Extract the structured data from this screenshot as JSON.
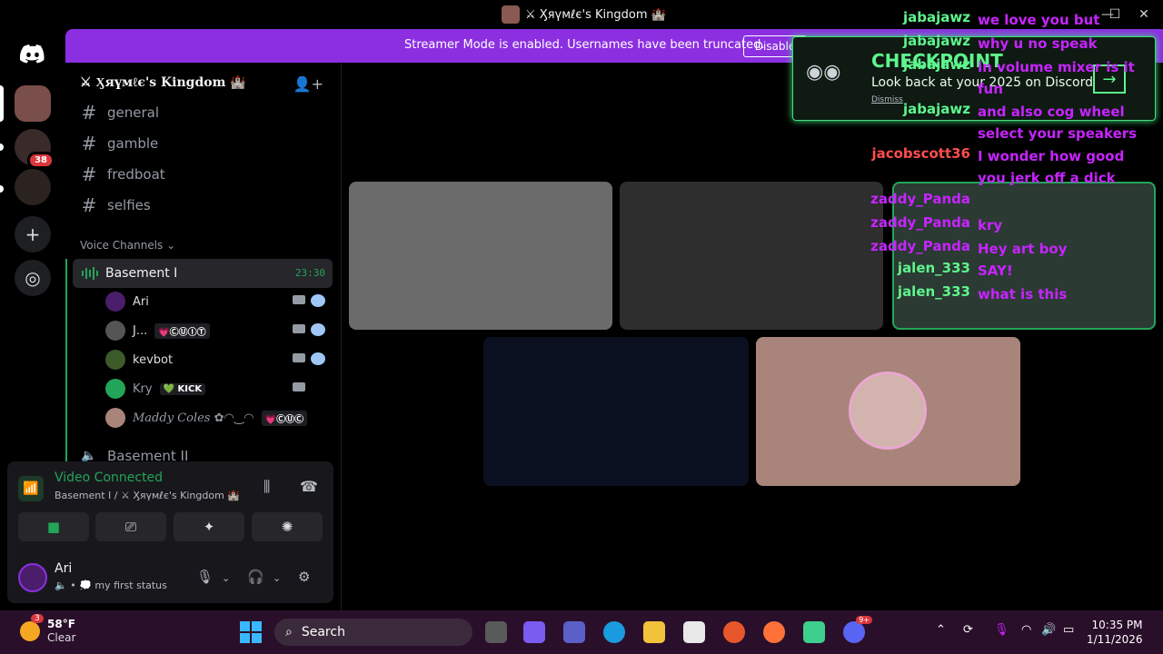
{
  "window": {
    "title": "⚔ Ӽяүмℓє's Kingdom 🏰"
  },
  "banner": {
    "message": "Streamer Mode is enabled. Usernames have been truncated.",
    "button": "Disable"
  },
  "guilds": {
    "dm_badge": "38"
  },
  "server": {
    "name": "⚔ Ӽяүмℓє's Kingdom 🏰"
  },
  "channels": [
    {
      "name": "general"
    },
    {
      "name": "gamble"
    },
    {
      "name": "fredboat"
    },
    {
      "name": "selfies"
    }
  ],
  "voice": {
    "category": "Voice Channels",
    "channel": "Basement I",
    "timer": "23:30",
    "users": [
      {
        "name": "Ari",
        "tag": ""
      },
      {
        "name": "J...",
        "tag": "💗ⒸⓊⒾⓉ"
      },
      {
        "name": "kevbot",
        "tag": ""
      },
      {
        "name": "Kry",
        "tag": "💚 KICK"
      },
      {
        "name": "𝑀𝑎𝑑𝑑𝑦 𝐶𝑜𝑙𝑒𝑠 ✿◠‿◠",
        "tag": "💗ⒸⓊⒸ"
      }
    ],
    "next_channel": "Basement II"
  },
  "connection": {
    "status": "Video Connected",
    "location": "Basement I / ⚔ Ӽяүмℓє's Kingdom 🏰"
  },
  "user": {
    "name": "Ari",
    "status": "my first status"
  },
  "promo": {
    "title": "CHECKPOINT",
    "subtitle": "Look back at your 2025 on Discord",
    "dismiss": "Dismiss"
  },
  "chat": [
    {
      "user": "jabajawz",
      "msg": "we love you but",
      "color": "#5ef58d"
    },
    {
      "user": "jabajawz",
      "msg": "why u no speak",
      "color": "#5ef58d"
    },
    {
      "user": "jabajawz",
      "msg": "in volume mixer is it fun",
      "color": "#5ef58d"
    },
    {
      "user": "jabajawz",
      "msg": "and also cog wheel select your speakers",
      "color": "#5ef58d"
    },
    {
      "user": "jacobscott36",
      "msg": "I wonder how good you jerk off a dick",
      "color": "#ff4d4d"
    },
    {
      "user": "zaddy_Panda",
      "msg": "",
      "color": "#c724ff"
    },
    {
      "user": "zaddy_Panda",
      "msg": "kry",
      "color": "#c724ff"
    },
    {
      "user": "zaddy_Panda",
      "msg": "Hey art boy",
      "color": "#c724ff"
    },
    {
      "user": "jalen_333",
      "msg": "SAY!",
      "color": "#5ef58d"
    },
    {
      "user": "jalen_333",
      "msg": "what is this",
      "color": "#5ef58d"
    }
  ],
  "taskbar": {
    "weather_temp": "58°F",
    "weather_desc": "Clear",
    "weather_badge": "3",
    "search": "Search",
    "time": "10:35 PM",
    "date": "1/11/2026",
    "discord_badge": "9+"
  }
}
